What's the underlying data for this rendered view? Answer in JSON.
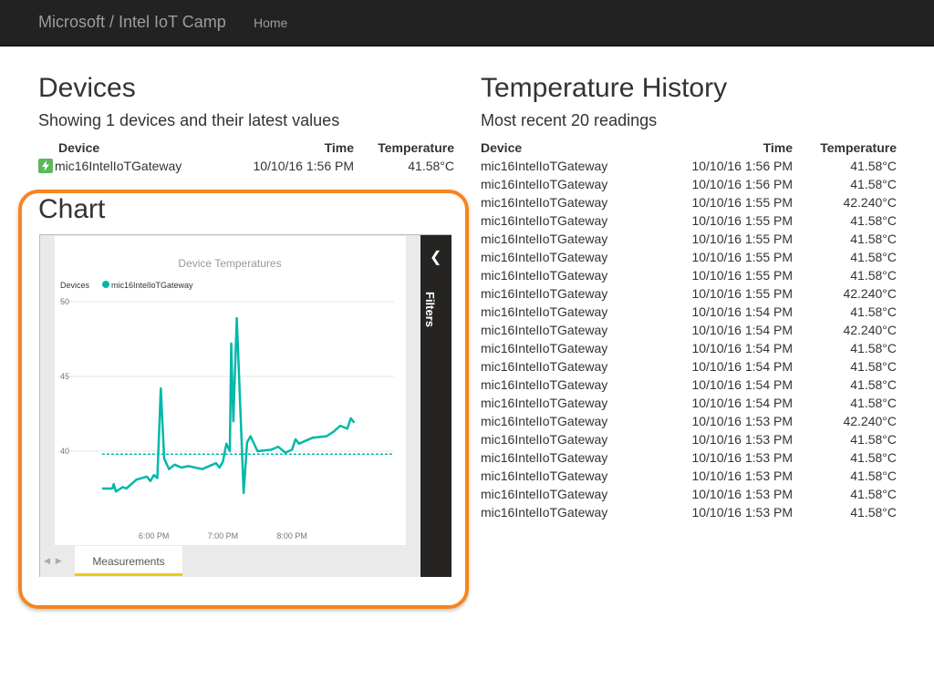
{
  "navbar": {
    "brand": "Microsoft / Intel IoT Camp",
    "home": "Home"
  },
  "devices": {
    "title": "Devices",
    "subtitle": "Showing 1 devices and their latest values",
    "columns": [
      "Device",
      "Time",
      "Temperature"
    ],
    "rows": [
      {
        "device": "mic16IntelIoTGateway",
        "time": "10/10/16 1:56 PM",
        "temperature": "41.58°C"
      }
    ]
  },
  "chart_section": {
    "title": "Chart"
  },
  "history": {
    "title": "Temperature History",
    "subtitle": "Most recent 20 readings",
    "columns": [
      "Device",
      "Time",
      "Temperature"
    ],
    "rows": [
      [
        "mic16IntelIoTGateway",
        "10/10/16 1:56 PM",
        "41.58°C"
      ],
      [
        "mic16IntelIoTGateway",
        "10/10/16 1:56 PM",
        "41.58°C"
      ],
      [
        "mic16IntelIoTGateway",
        "10/10/16 1:55 PM",
        "42.240°C"
      ],
      [
        "mic16IntelIoTGateway",
        "10/10/16 1:55 PM",
        "41.58°C"
      ],
      [
        "mic16IntelIoTGateway",
        "10/10/16 1:55 PM",
        "41.58°C"
      ],
      [
        "mic16IntelIoTGateway",
        "10/10/16 1:55 PM",
        "41.58°C"
      ],
      [
        "mic16IntelIoTGateway",
        "10/10/16 1:55 PM",
        "41.58°C"
      ],
      [
        "mic16IntelIoTGateway",
        "10/10/16 1:55 PM",
        "42.240°C"
      ],
      [
        "mic16IntelIoTGateway",
        "10/10/16 1:54 PM",
        "41.58°C"
      ],
      [
        "mic16IntelIoTGateway",
        "10/10/16 1:54 PM",
        "42.240°C"
      ],
      [
        "mic16IntelIoTGateway",
        "10/10/16 1:54 PM",
        "41.58°C"
      ],
      [
        "mic16IntelIoTGateway",
        "10/10/16 1:54 PM",
        "41.58°C"
      ],
      [
        "mic16IntelIoTGateway",
        "10/10/16 1:54 PM",
        "41.58°C"
      ],
      [
        "mic16IntelIoTGateway",
        "10/10/16 1:54 PM",
        "41.58°C"
      ],
      [
        "mic16IntelIoTGateway",
        "10/10/16 1:53 PM",
        "42.240°C"
      ],
      [
        "mic16IntelIoTGateway",
        "10/10/16 1:53 PM",
        "41.58°C"
      ],
      [
        "mic16IntelIoTGateway",
        "10/10/16 1:53 PM",
        "41.58°C"
      ],
      [
        "mic16IntelIoTGateway",
        "10/10/16 1:53 PM",
        "41.58°C"
      ],
      [
        "mic16IntelIoTGateway",
        "10/10/16 1:53 PM",
        "41.58°C"
      ],
      [
        "mic16IntelIoTGateway",
        "10/10/16 1:53 PM",
        "41.58°C"
      ]
    ]
  },
  "report": {
    "filters_label": "Filters",
    "filters_icon": "chevron-left-icon",
    "tab_label": "Measurements"
  },
  "chart_data": {
    "type": "line",
    "title": "Device Temperatures",
    "legend_title": "Devices",
    "legend_position": "top-left",
    "series": [
      {
        "name": "mic16IntelIoTGateway",
        "color": "#01b8aa",
        "x": [
          17.25,
          17.4,
          17.42,
          17.45,
          17.55,
          17.6,
          17.75,
          17.9,
          17.95,
          18.0,
          18.05,
          18.1,
          18.15,
          18.2,
          18.22,
          18.3,
          18.4,
          18.5,
          18.7,
          18.9,
          18.95,
          19.0,
          19.05,
          19.1,
          19.12,
          19.15,
          19.2,
          19.25,
          19.3,
          19.35,
          19.4,
          19.5,
          19.7,
          19.8,
          19.9,
          20.0,
          20.05,
          20.1,
          20.3,
          20.5,
          20.6,
          20.7,
          20.8,
          20.85,
          20.9
        ],
        "y": [
          37.5,
          37.5,
          37.8,
          37.3,
          37.6,
          37.5,
          38.1,
          38.3,
          38.0,
          38.4,
          38.2,
          44.2,
          39.5,
          39.0,
          38.8,
          39.1,
          38.9,
          39.0,
          38.8,
          39.2,
          38.9,
          39.3,
          40.5,
          40.0,
          47.2,
          42.0,
          48.9,
          43.0,
          37.2,
          40.6,
          41.0,
          40.0,
          40.1,
          40.3,
          39.9,
          40.1,
          40.8,
          40.5,
          40.9,
          41.0,
          41.3,
          41.7,
          41.5,
          42.2,
          41.9
        ]
      }
    ],
    "reference_line": 39.8,
    "xticks": [
      {
        "v": 18,
        "label": "6:00 PM"
      },
      {
        "v": 19,
        "label": "7:00 PM"
      },
      {
        "v": 20,
        "label": "8:00 PM"
      }
    ],
    "yticks": [
      40,
      45,
      50
    ],
    "xlim": [
      16.75,
      21.45
    ],
    "ylim": [
      35,
      50
    ],
    "grid": true
  }
}
